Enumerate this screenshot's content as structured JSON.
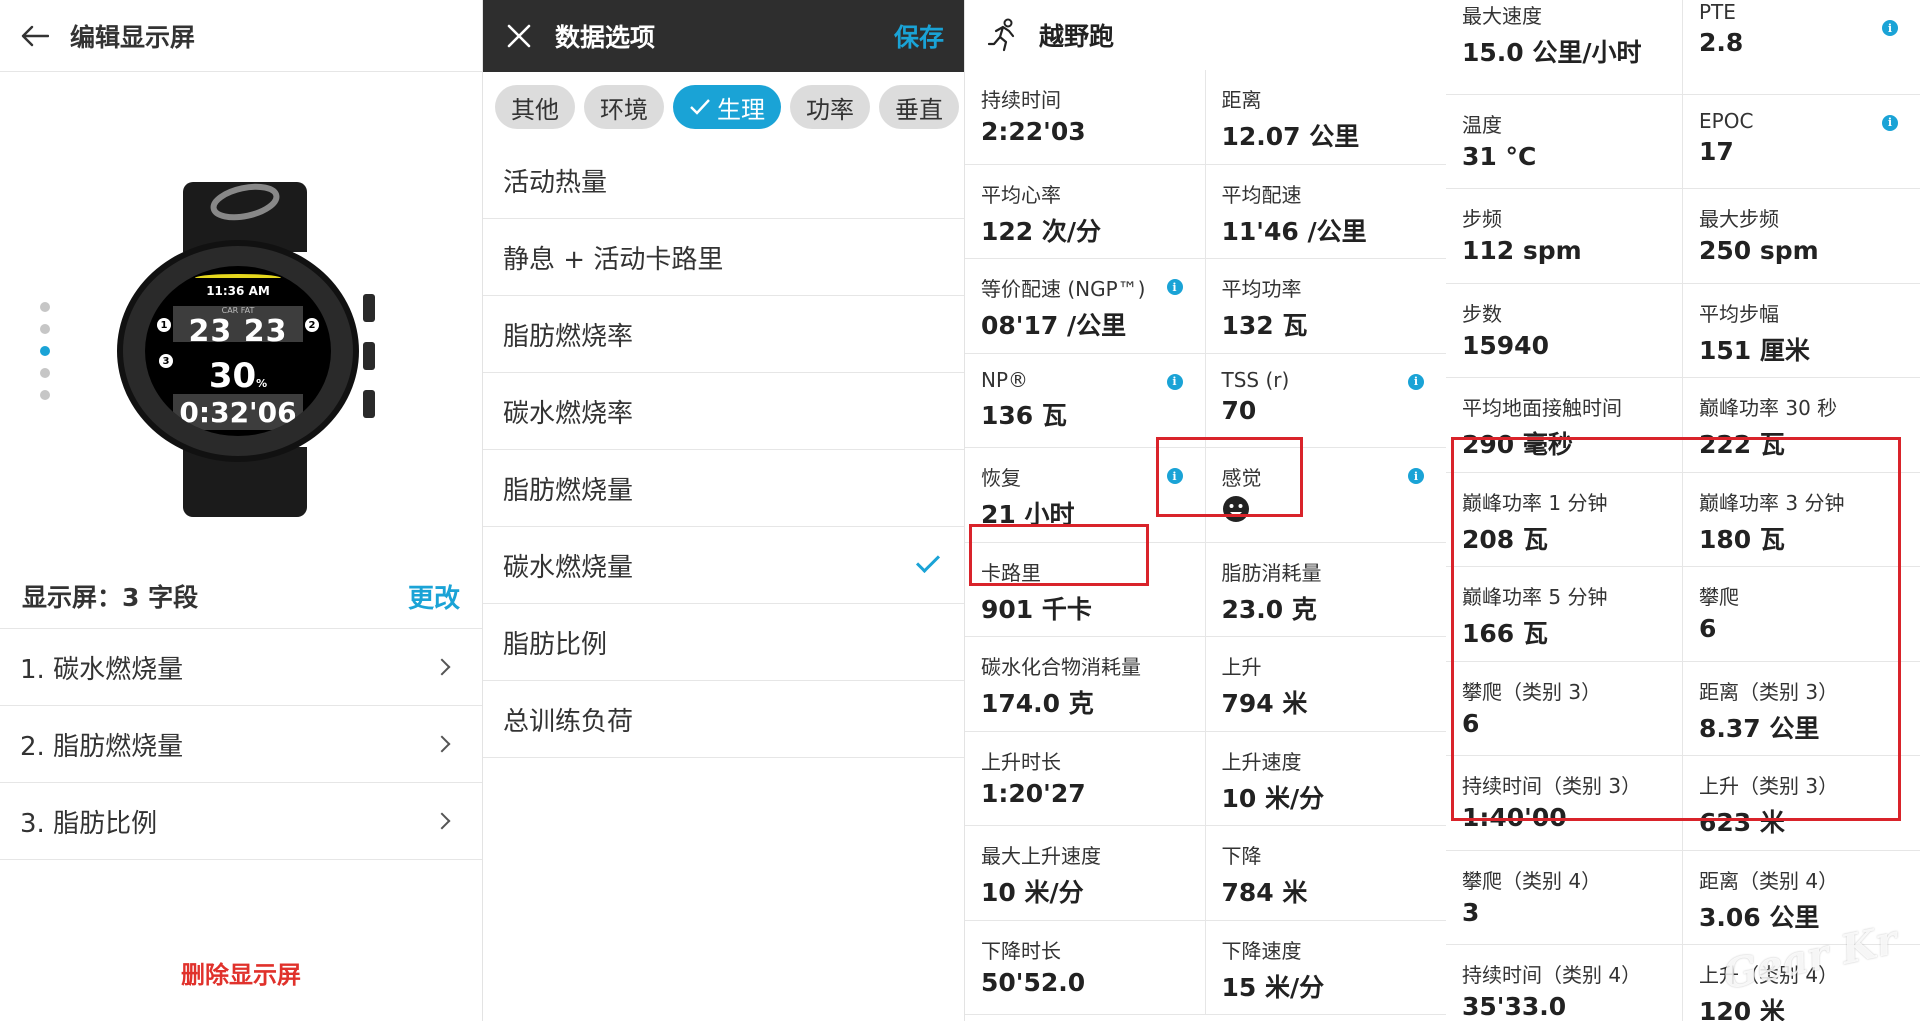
{
  "panel1": {
    "title": "编辑显示屏",
    "watch": {
      "time": "11:36 AM",
      "labels": "CAR  FAT",
      "nums": "23 23",
      "pct": "30",
      "pct_unit": "%",
      "timer": "0:32'06",
      "markers": [
        "1",
        "2",
        "3"
      ]
    },
    "section_label": "显示屏：3 字段",
    "change_label": "更改",
    "items": [
      "1. 碳水燃烧量",
      "2. 脂肪燃烧量",
      "3. 脂肪比例"
    ],
    "delete_label": "删除显示屏"
  },
  "panel2": {
    "title": "数据选项",
    "save_label": "保存",
    "chips": [
      "其他",
      "环境",
      "生理",
      "功率",
      "垂直"
    ],
    "active_chip": "生理",
    "items": [
      "活动热量",
      "静息 + 活动卡路里",
      "脂肪燃烧率",
      "碳水燃烧率",
      "脂肪燃烧量",
      "碳水燃烧量",
      "脂肪比例",
      "总训练负荷"
    ],
    "checked_item": "碳水燃烧量"
  },
  "panel3": {
    "title": "越野跑",
    "cells": [
      {
        "label": "持续时间",
        "value": "2:22'03"
      },
      {
        "label": "距离",
        "value": "12.07 公里"
      },
      {
        "label": "平均心率",
        "value": "122 次/分"
      },
      {
        "label": "平均配速",
        "value": "11'46 /公里"
      },
      {
        "label": "等价配速 (NGP™)",
        "value": "08'17 /公里",
        "info": true
      },
      {
        "label": "平均功率",
        "value": "132 瓦"
      },
      {
        "label": "NP®",
        "value": "136 瓦",
        "info": true
      },
      {
        "label": "TSS (r)",
        "value": "70",
        "info": true
      },
      {
        "label": "恢复",
        "value": "21 小时",
        "info": true
      },
      {
        "label": "感觉",
        "value": "",
        "info": true,
        "icon": "smiley-icon"
      },
      {
        "label": "卡路里",
        "value": "901 千卡"
      },
      {
        "label": "脂肪消耗量",
        "value": "23.0 克"
      },
      {
        "label": "碳水化合物消耗量",
        "value": "174.0 克"
      },
      {
        "label": "上升",
        "value": "794 米"
      },
      {
        "label": "上升时长",
        "value": "1:20'27"
      },
      {
        "label": "上升速度",
        "value": "10 米/分"
      },
      {
        "label": "最大上升速度",
        "value": "10 米/分"
      },
      {
        "label": "下降",
        "value": "784 米"
      },
      {
        "label": "下降时长",
        "value": "50'52.0"
      },
      {
        "label": "下降速度",
        "value": "15 米/分"
      }
    ]
  },
  "panel4": {
    "top_cells": [
      {
        "label": "最大速度",
        "value": "15.0 公里/小时"
      },
      {
        "label": "PTE",
        "value": "2.8",
        "info": true
      }
    ],
    "cells": [
      {
        "label": "温度",
        "value": "31 °C"
      },
      {
        "label": "EPOC",
        "value": "17",
        "info": true
      },
      {
        "label": "步频",
        "value": "112 spm"
      },
      {
        "label": "最大步频",
        "value": "250 spm"
      },
      {
        "label": "步数",
        "value": "15940"
      },
      {
        "label": "平均步幅",
        "value": "151 厘米"
      },
      {
        "label": "平均地面接触时间",
        "value": "290 毫秒"
      },
      {
        "label": "巅峰功率 30 秒",
        "value": "222 瓦"
      },
      {
        "label": "巅峰功率 1 分钟",
        "value": "208 瓦"
      },
      {
        "label": "巅峰功率 3 分钟",
        "value": "180 瓦"
      },
      {
        "label": "巅峰功率 5 分钟",
        "value": "166 瓦"
      },
      {
        "label": "攀爬",
        "value": "6"
      },
      {
        "label": "攀爬（类别 3）",
        "value": "6"
      },
      {
        "label": "距离（类别 3）",
        "value": "8.37 公里"
      },
      {
        "label": "持续时间（类别 3）",
        "value": "1:40'00"
      },
      {
        "label": "上升（类别 3）",
        "value": "623 米"
      },
      {
        "label": "攀爬（类别 4）",
        "value": "3"
      },
      {
        "label": "距离（类别 4）",
        "value": "3.06 公里"
      },
      {
        "label": "持续时间（类别 4）",
        "value": "35'33.0"
      },
      {
        "label": "上升（类别 4）",
        "value": "120 米"
      }
    ],
    "watermark": "Gear Kr"
  },
  "colors": {
    "accent": "#1aa3d6",
    "highlight_box": "#d9232a",
    "delete": "#e0312b",
    "dark_header": "#2e2e2e"
  }
}
